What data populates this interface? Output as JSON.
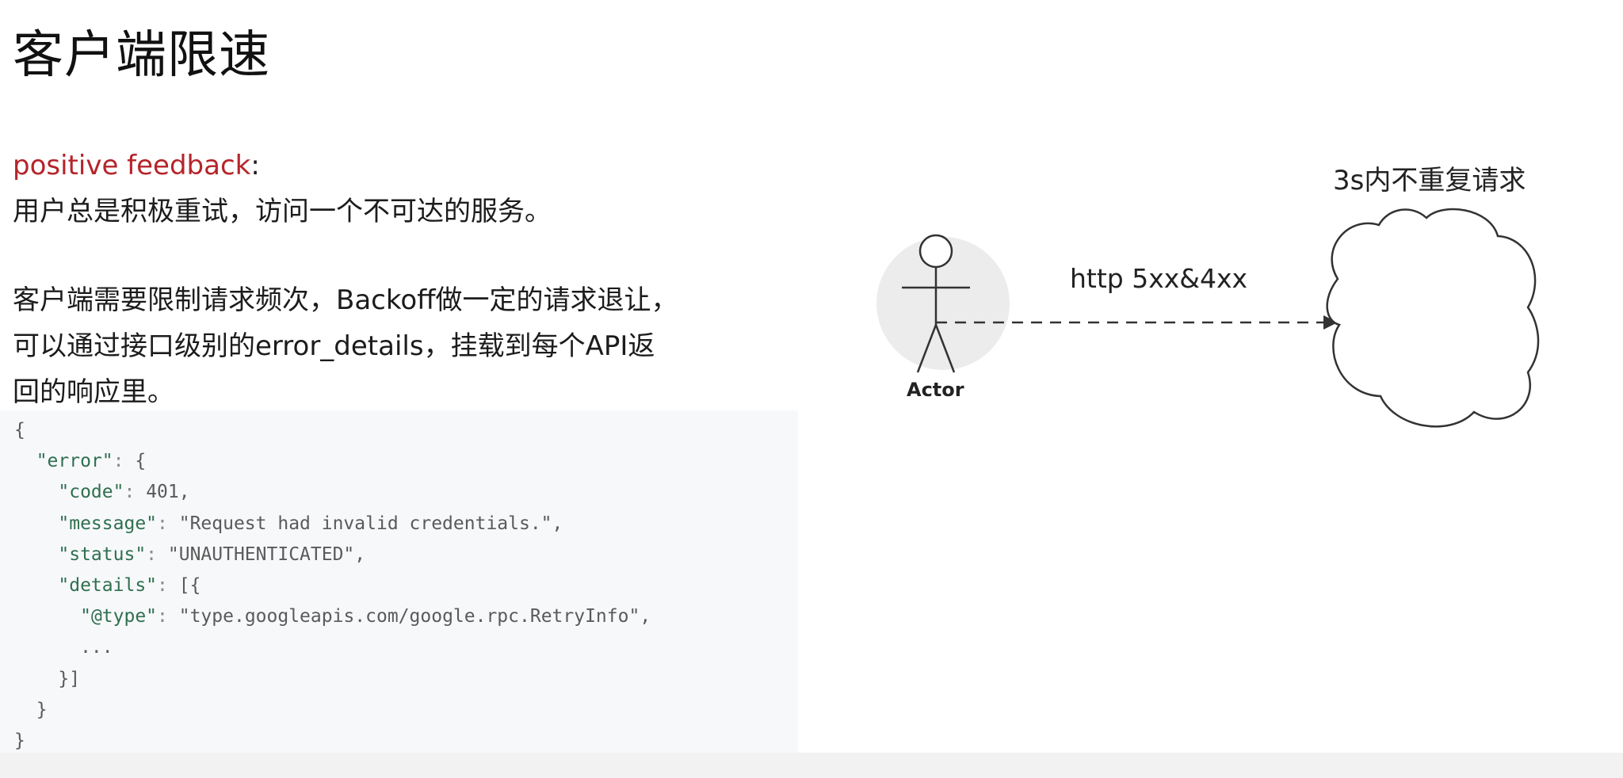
{
  "slide": {
    "title": "客户端限速",
    "positive_feedback": {
      "label": "positive feedback",
      "colon": ":",
      "text": "用户总是积极重试，访问一个不可达的服务。"
    },
    "paragraph": {
      "line1": "客户端需要限制请求频次，Backoff做一定的请求退让，",
      "line2": "可以通过接口级别的error_details，挂载到每个API返",
      "line3": "回的响应里。"
    },
    "code_lines": [
      "{",
      "  \"error\": {",
      "    \"code\": 401,",
      "    \"message\": \"Request had invalid credentials.\",",
      "    \"status\": \"UNAUTHENTICATED\",",
      "    \"details\": [{",
      "      \"@type\": \"type.googleapis.com/google.rpc.RetryInfo\",",
      "      ...",
      "    }]",
      "  }",
      "}"
    ]
  },
  "diagram": {
    "actor_label": "Actor",
    "arrow_label": "http 5xx&4xx",
    "cloud_label": "3s内不重复请求",
    "arrow_style": "dashed"
  },
  "colors": {
    "accent_red": "#b5242a",
    "code_background": "#f7f8fa",
    "code_key": "#2f6f4f",
    "code_number": "#2b5fa8"
  }
}
